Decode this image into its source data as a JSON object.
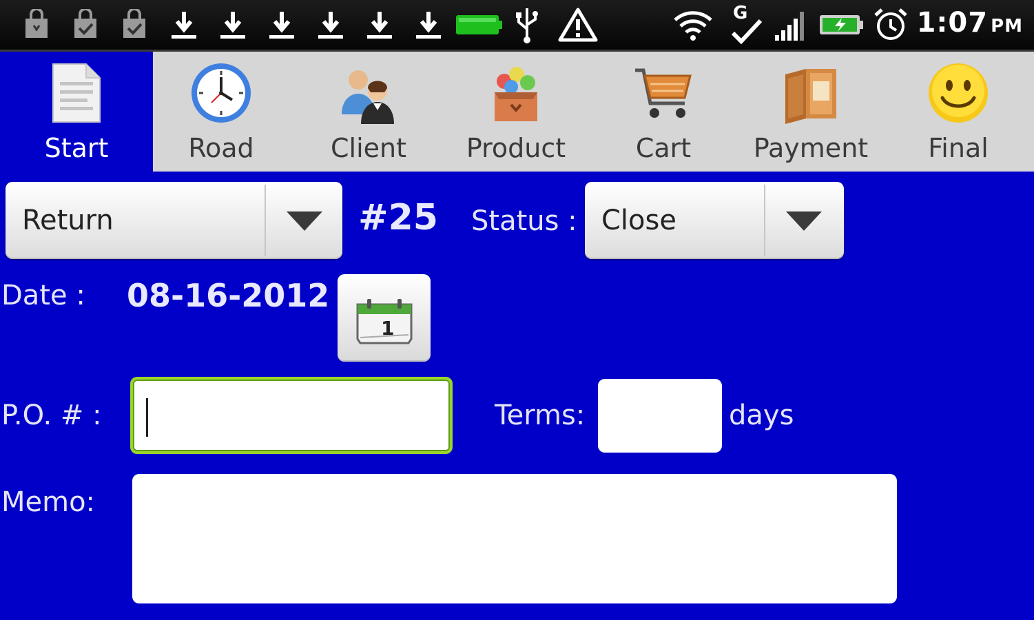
{
  "status_bar": {
    "time": "1:07",
    "ampm": "PM",
    "network_label": "G",
    "left_icons": [
      "bag-icon",
      "bag-check-icon",
      "bag-check-icon",
      "download-icon",
      "download-icon",
      "download-icon",
      "download-icon",
      "download-icon",
      "download-icon",
      "battery-full-icon",
      "usb-icon",
      "warning-icon"
    ],
    "right_icons": [
      "wifi-icon",
      "g-sync-icon",
      "signal-icon",
      "battery-charging-icon",
      "alarm-icon"
    ]
  },
  "tabs": [
    {
      "label": "Start",
      "icon": "document-icon",
      "active": true
    },
    {
      "label": "Road",
      "icon": "clock-icon",
      "active": false
    },
    {
      "label": "Client",
      "icon": "people-icon",
      "active": false
    },
    {
      "label": "Product",
      "icon": "box-icon",
      "active": false
    },
    {
      "label": "Cart",
      "icon": "cart-icon",
      "active": false
    },
    {
      "label": "Payment",
      "icon": "wallet-icon",
      "active": false
    },
    {
      "label": "Final",
      "icon": "smiley-icon",
      "active": false
    }
  ],
  "form": {
    "type_selected": "Return",
    "order_number": "#25",
    "status_label": "Status :",
    "status_selected": "Close",
    "date_label": "Date :",
    "date_value": "08-16-2012",
    "po_label": "P.O. # :",
    "po_value": "",
    "terms_label": "Terms:",
    "terms_value": "",
    "terms_unit": "days",
    "memo_label": "Memo:",
    "memo_value": ""
  },
  "calendar_button": {
    "icon": "calendar-icon",
    "day": "1"
  },
  "colors": {
    "background": "#0000c8",
    "tabbar": "#d6d6d6",
    "focus_border": "#9ad32a"
  }
}
